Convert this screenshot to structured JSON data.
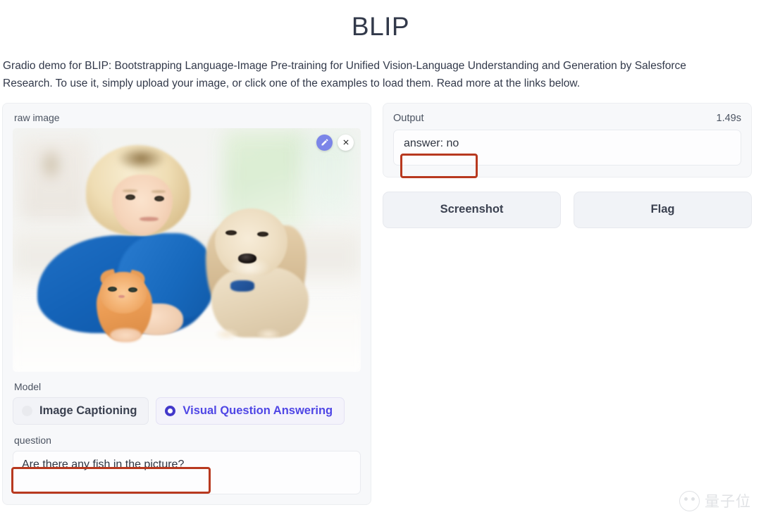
{
  "header": {
    "title": "BLIP",
    "description": "Gradio demo for BLIP: Bootstrapping Language-Image Pre-training for Unified Vision-Language Understanding and Generation by Salesforce Research. To use it, simply upload your image, or click one of the examples to load them. Read more at the links below."
  },
  "left_panel": {
    "image_label": "raw image",
    "image_alt": "A blond curly-haired boy in a blue shirt lying on a white rug with a ginger kitten and a cream cocker spaniel puppy",
    "tools": {
      "edit_icon": "pencil-icon",
      "clear_icon": "close-icon"
    },
    "model": {
      "label": "Model",
      "options": [
        {
          "label": "Image Captioning",
          "selected": false
        },
        {
          "label": "Visual Question Answering",
          "selected": true
        }
      ]
    },
    "question": {
      "label": "question",
      "value": "Are there any fish in the picture?",
      "placeholder": ""
    }
  },
  "right_panel": {
    "output": {
      "label": "Output",
      "duration": "1.49s",
      "value": "answer: no"
    },
    "actions": [
      {
        "label": "Screenshot"
      },
      {
        "label": "Flag"
      }
    ]
  },
  "watermark": {
    "text": "量子位"
  },
  "colors": {
    "accent": "#4f46e5",
    "annotation": "#b8391f",
    "panel_bg": "#f7f8fa",
    "button_bg": "#f1f3f7",
    "title": "#32394a",
    "edit_button": "#7b85e8"
  }
}
